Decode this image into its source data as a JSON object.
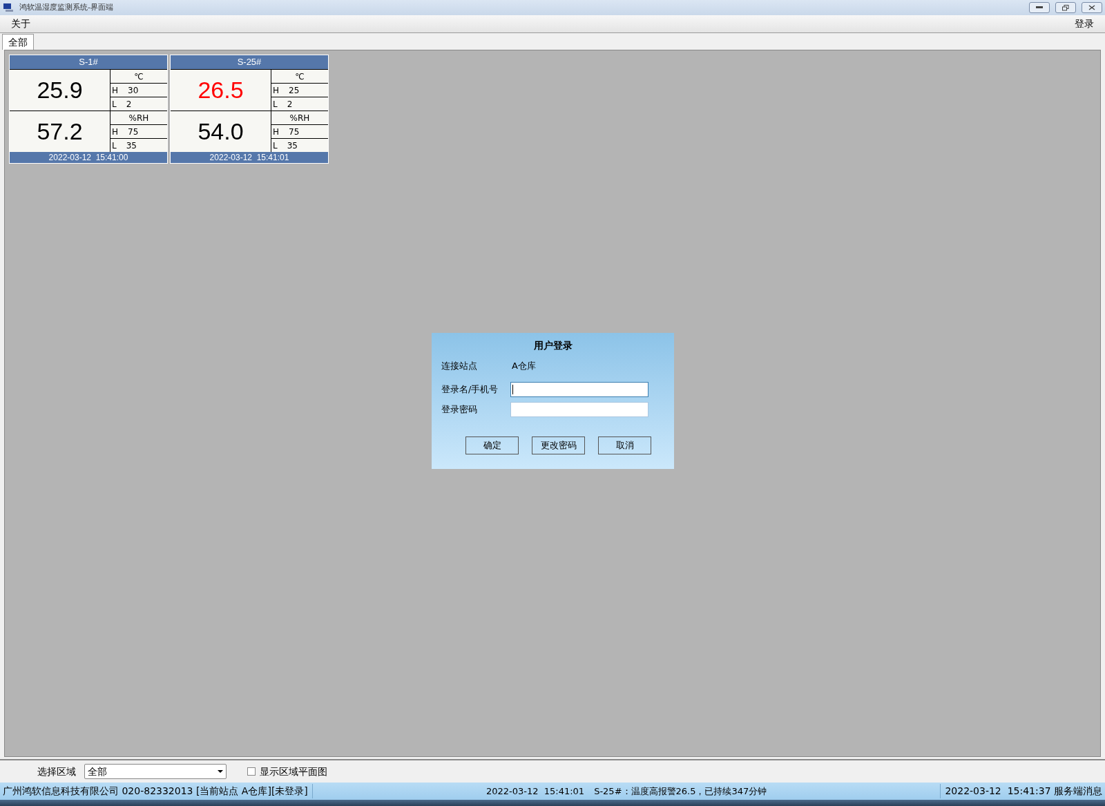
{
  "window": {
    "title": "鸿软温湿度监测系统-界面端"
  },
  "menu": {
    "left": [
      {
        "label": "关于"
      }
    ],
    "right": [
      {
        "label": "登录"
      }
    ]
  },
  "tabs": [
    {
      "label": "全部",
      "selected": true
    }
  ],
  "sensors": [
    {
      "name": "S-1#",
      "readings": [
        {
          "value": "25.9",
          "alarm": false,
          "unit": "℃",
          "high_label": "H",
          "high": "30",
          "low_label": "L",
          "low": "2"
        },
        {
          "value": "57.2",
          "alarm": false,
          "unit": "%RH",
          "high_label": "H",
          "high": "75",
          "low_label": "L",
          "low": "35"
        }
      ],
      "timestamp": "2022-03-12  15:41:00"
    },
    {
      "name": "S-25#",
      "readings": [
        {
          "value": "26.5",
          "alarm": true,
          "unit": "℃",
          "high_label": "H",
          "high": "25",
          "low_label": "L",
          "low": "2"
        },
        {
          "value": "54.0",
          "alarm": false,
          "unit": "%RH",
          "high_label": "H",
          "high": "75",
          "low_label": "L",
          "low": "35"
        }
      ],
      "timestamp": "2022-03-12  15:41:01"
    }
  ],
  "login_dialog": {
    "title": "用户登录",
    "station_label": "连接站点",
    "station": "A仓库",
    "fields": [
      {
        "label": "登录名/手机号",
        "focused": true
      },
      {
        "label": "登录密码",
        "focused": false
      }
    ],
    "buttons": [
      "确定",
      "更改密码",
      "取消"
    ]
  },
  "filter": {
    "label": "选择区域",
    "value": "全部",
    "checkbox": {
      "label": "显示区域平面图",
      "checked": false
    }
  },
  "status_bar": {
    "left": "广州鸿软信息科技有限公司 020-82332013 [当前站点 A仓库][未登录]",
    "alarm_time": "2022-03-12  15:41:01",
    "alarm_message": "S-25#：温度高报警26.5，已持续347分钟",
    "right": "2022-03-12  15:41:37 服务端消息"
  }
}
